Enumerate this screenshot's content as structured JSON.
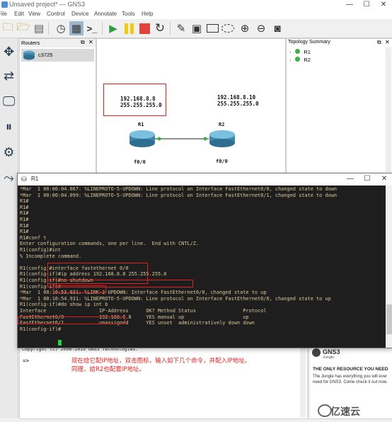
{
  "window": {
    "title": "Unsaved project* — GNS3",
    "controls": [
      "—",
      "☐",
      "✕"
    ]
  },
  "menu": [
    "File",
    "Edit",
    "View",
    "Control",
    "Device",
    "Annotate",
    "Tools",
    "Help"
  ],
  "toolbar_icons": [
    "new-project-icon",
    "open-project-icon",
    "save-project-icon",
    "snapshot-icon",
    "show-labels-icon",
    "console-all-icon",
    "start-all-icon",
    "suspend-all-icon",
    "stop-all-icon",
    "reload-all-icon",
    "add-note-icon",
    "insert-picture-icon",
    "draw-rectangle-icon",
    "draw-ellipse-icon",
    "zoom-in-icon",
    "zoom-out-icon",
    "screenshot-icon"
  ],
  "routers_dock": {
    "title": "Routers",
    "items": [
      "c3725"
    ]
  },
  "canvas": {
    "note_r1": [
      "192.168.8.8",
      "255.255.255.0"
    ],
    "note_r2": [
      "192.168.8.10",
      "255.255.255.0"
    ],
    "r1": {
      "name": "R1",
      "interface": "f0/0"
    },
    "r2": {
      "name": "R2",
      "interface": "f0/0"
    }
  },
  "topology": {
    "title": "Topology Summary",
    "nodes": [
      "R1",
      "R2"
    ],
    "status_color": "#3cb043"
  },
  "terminal": {
    "title": "R1",
    "controls": [
      "—",
      "☐",
      "✕"
    ],
    "lines": [
      "*Mar  1 00:00:04.067: %LINEPROTO-5-UPDOWN: Line protocol on Interface FastEthernet0/0, changed state to down",
      "*Mar  1 00:00:04.099: %LINEPROTO-5-UPDOWN: Line protocol on Interface FastEthernet0/1, changed state to down",
      "R1#",
      "R1#",
      "R1#",
      "R1#",
      "R1#",
      "R1#",
      "R1#conf t",
      "Enter configuration commands, one per line.  End with CNTL/Z.",
      "R1(config)#int",
      "% Incomplete command.",
      "",
      "R1(config)#interface fastethernet 0/0",
      "R1(config-if)#ip address 192.168.8.8 255.255.255.0",
      "R1(config-if)#no shutdown",
      "R1(config-if)#",
      "*Mar  1 00:10:53.931: %LINK-3-UPDOWN: Interface FastEthernet0/0, changed state to up",
      "*Mar  1 00:10:54.931: %LINEPROTO-5-UPDOWN: Line protocol on Interface FastEthernet0/0, changed state to up",
      "R1(config-if)#do show ip int b",
      "Interface                  IP-Address      OK? Method Status                Protocol",
      "FastEthernet0/0            192.168.8.8     YES manual up                    up",
      "FastEthernet0/1            unassigned      YES unset  administratively down down",
      "R1(config-if)#"
    ]
  },
  "console": {
    "copyright": "Copyright (c) 2006-2019 GNS3 Technologies.",
    "prompt": "=>",
    "annotation_line1": "现在给它配IP地址，双击图标，输入如下几个命令，并配入IP地址。",
    "annotation_line2": "同理，给R2也配置IP地址。"
  },
  "news": {
    "brand": "GNS3",
    "brand_sub": "Jungle",
    "headline": "THE ONLY RESOURCE YOU NEED",
    "body": "The Jungle has everything you will ever need for GNS3. Come check it out now.",
    "watermark": "亿速云"
  },
  "colors": {
    "terminal_bg": "#1e1e1e",
    "terminal_fg": "#d9c79a",
    "annotation_red": "#e02020"
  }
}
